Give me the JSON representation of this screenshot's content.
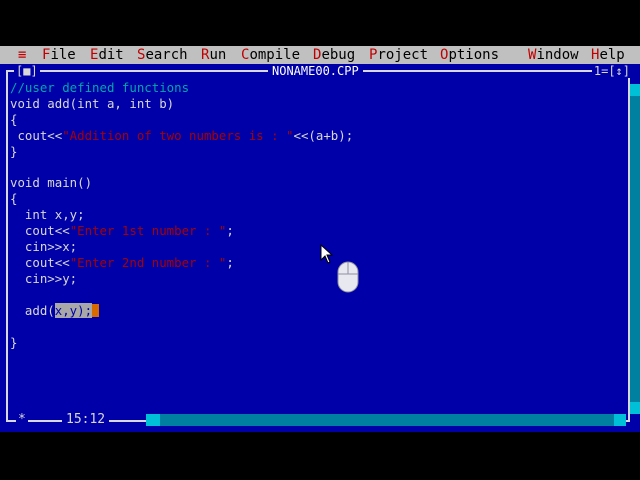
{
  "menu": {
    "system": "≡",
    "items": [
      {
        "hotkey": "F",
        "rest": "ile"
      },
      {
        "hotkey": "E",
        "rest": "dit"
      },
      {
        "hotkey": "S",
        "rest": "earch"
      },
      {
        "hotkey": "R",
        "rest": "un"
      },
      {
        "hotkey": "C",
        "rest": "ompile"
      },
      {
        "hotkey": "D",
        "rest": "ebug"
      },
      {
        "hotkey": "P",
        "rest": "roject"
      },
      {
        "hotkey": "O",
        "rest": "ptions"
      },
      {
        "hotkey": "W",
        "rest": "indow"
      },
      {
        "hotkey": "H",
        "rest": "elp"
      }
    ]
  },
  "window": {
    "close_button": "[■]",
    "title": "NONAME00.CPP",
    "number_zoom": "1=[↕]"
  },
  "code": {
    "l1": "//user defined functions",
    "l2": "void add(int a, int b)",
    "l3": "{",
    "l4_pre": " cout<<",
    "l4_str": "\"Addition of two numbers is : \"",
    "l4_post": "<<(a+b);",
    "l5": "}",
    "l6": "",
    "l7": "void main()",
    "l8": "{",
    "l9": "  int x,y;",
    "l10_pre": "  cout<<",
    "l10_str": "\"Enter 1st number : \"",
    "l10_post": ";",
    "l11": "  cin>>x;",
    "l12_pre": "  cout<<",
    "l12_str": "\"Enter 2nd number : \"",
    "l12_post": ";",
    "l13": "  cin>>y;",
    "l14": "",
    "l15_pre": "  add(",
    "l15_sel": "x,y);",
    "l16": "",
    "l17": "}"
  },
  "status": {
    "star": "*",
    "position": "15:12"
  },
  "colors": {
    "editor_bg": "#0000a8",
    "menu_bg": "#c0c0c0",
    "hotkey": "#c00000",
    "comment": "#00a8a8",
    "string": "#a80000",
    "cursor_block": "#d86a00"
  }
}
